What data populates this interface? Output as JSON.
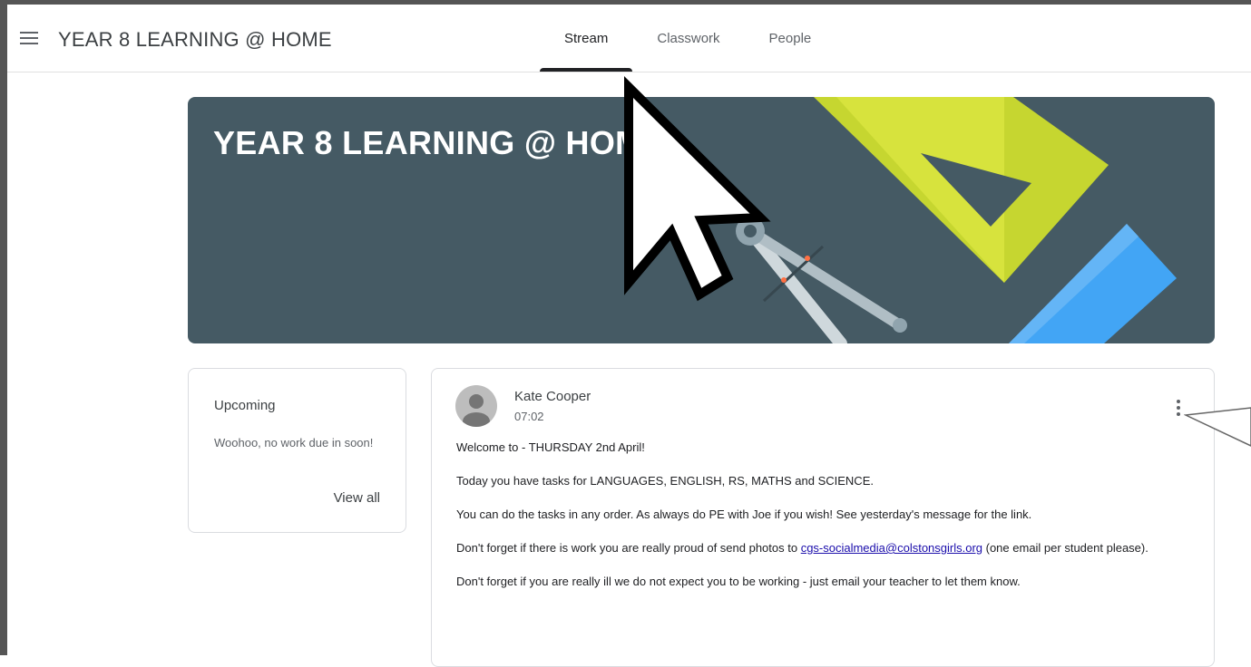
{
  "header": {
    "class_title": "YEAR 8 LEARNING @ HOME",
    "tabs": [
      {
        "label": "Stream",
        "active": true
      },
      {
        "label": "Classwork",
        "active": false
      },
      {
        "label": "People",
        "active": false
      }
    ]
  },
  "banner": {
    "title": "YEAR 8 LEARNING @ HOME",
    "background_color": "#455a64"
  },
  "upcoming": {
    "title": "Upcoming",
    "text": "Woohoo, no work due in soon!",
    "view_all_label": "View all"
  },
  "post": {
    "author": "Kate Cooper",
    "time": "07:02",
    "paragraphs": [
      "Welcome to - THURSDAY 2nd April!",
      "Today you have tasks for LANGUAGES, ENGLISH, RS, MATHS and SCIENCE.",
      "You can do the tasks in any order. As always do PE with Joe if you wish! See yesterday's message for the link."
    ],
    "photos_text_before": "Don't forget if there is work you are really proud of send photos to ",
    "photos_email": "cgs-socialmedia@colstonsgirls.org",
    "photos_text_after": " (one email per student please).",
    "ill_text": "Don't forget if you are really ill we do not expect you to be working - just email your teacher to let them know."
  },
  "icons": {
    "menu": "hamburger-menu-icon",
    "more": "more-vert-icon",
    "avatar": "default-avatar-icon",
    "cursor": "mouse-pointer-icon"
  }
}
